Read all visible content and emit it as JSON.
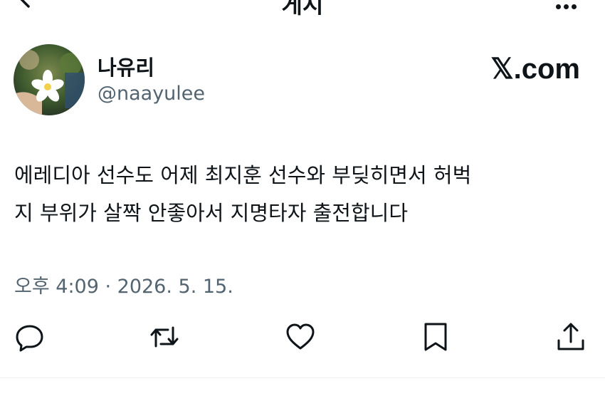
{
  "header": {
    "title": "게시",
    "back_icon": "back-arrow-icon",
    "more_icon": "more-horizontal-icon"
  },
  "author": {
    "display_name": "나유리",
    "handle": "@naayulee",
    "avatar_icon": "avatar-photo-flower"
  },
  "source": {
    "label": "𝕏.com"
  },
  "tweet": {
    "lines": [
      "에레디아 선수도 어제 최지훈 선수와 부딪히면서 허벅",
      "지 부위가 살짝 안좋아서 지명타자 출전합니다"
    ],
    "meta": "오후 4:09 · 2026. 5. 15."
  },
  "actions": {
    "reply_icon": "reply-icon",
    "retweet_icon": "retweet-icon",
    "like_icon": "heart-icon",
    "bookmark_icon": "bookmark-icon",
    "share_icon": "share-icon"
  },
  "colors": {
    "text": "#0f1419",
    "secondary": "#536471",
    "divider": "#eff3f4"
  }
}
